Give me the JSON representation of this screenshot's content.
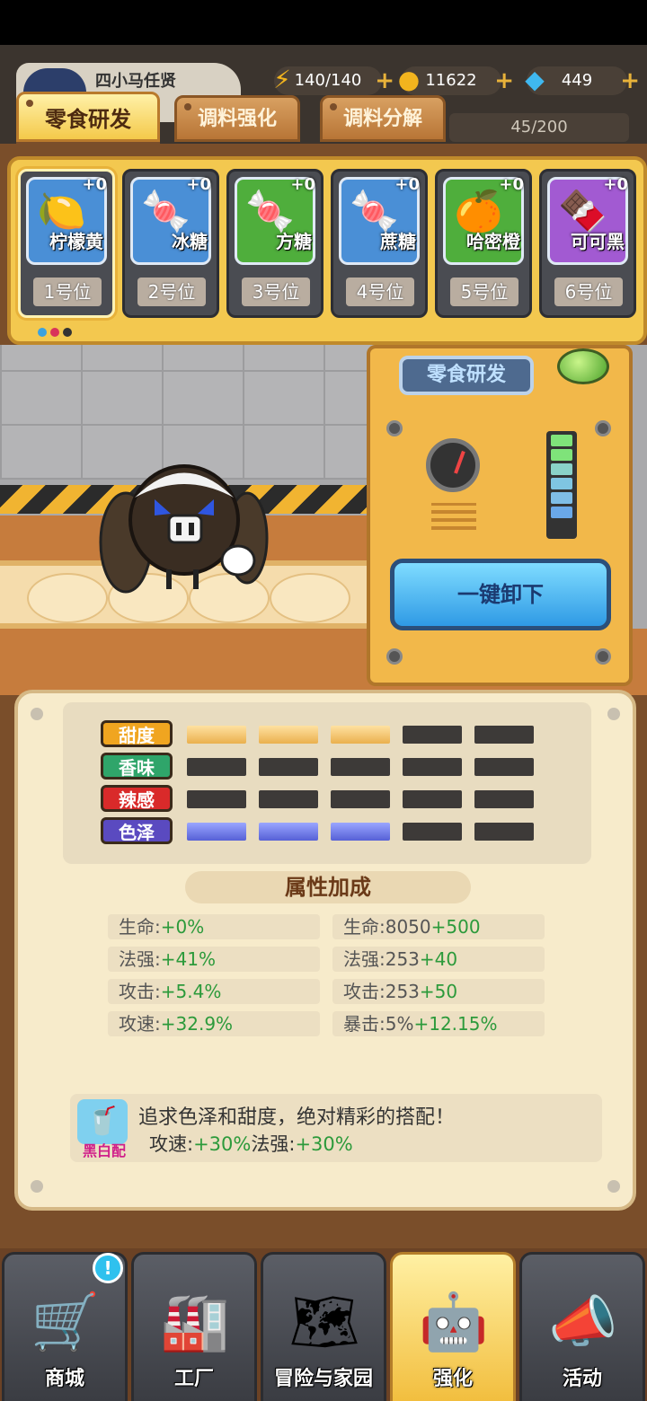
{
  "player": {
    "name": "四小马任贤"
  },
  "resources": {
    "stamina": {
      "value": "140/140",
      "icon": "lightning-icon"
    },
    "gold": {
      "value": "11622",
      "icon": "coin-icon"
    },
    "gems": {
      "value": "449",
      "icon": "diamond-icon"
    },
    "capacity": "45/200"
  },
  "tabs": [
    {
      "label": "零食研发",
      "active": true
    },
    {
      "label": "调料强化",
      "active": false
    },
    {
      "label": "调料分解",
      "active": false
    }
  ],
  "slots": [
    {
      "name": "柠檬黄",
      "count": "+0",
      "position": "1号位",
      "color": "#4a8fd6",
      "icon": "🍋"
    },
    {
      "name": "冰糖",
      "count": "+0",
      "position": "2号位",
      "color": "#4a8fd6",
      "icon": "🍬"
    },
    {
      "name": "方糖",
      "count": "+0",
      "position": "3号位",
      "color": "#4fae3c",
      "icon": "🍬"
    },
    {
      "name": "蔗糖",
      "count": "+0",
      "position": "4号位",
      "color": "#4a8fd6",
      "icon": "🍬"
    },
    {
      "name": "哈密橙",
      "count": "+0",
      "position": "5号位",
      "color": "#4fae3c",
      "icon": "🍊"
    },
    {
      "name": "可可黑",
      "count": "+0",
      "position": "6号位",
      "color": "#a25ad2",
      "icon": "🍫"
    }
  ],
  "machine": {
    "title": "零食研发",
    "unload_label": "一键卸下"
  },
  "attributes": [
    {
      "label": "甜度",
      "color": "#f0a520",
      "filled": 3,
      "max": 5,
      "style": "sweet"
    },
    {
      "label": "香味",
      "color": "#2fa56a",
      "filled": 0,
      "max": 5,
      "style": "none"
    },
    {
      "label": "辣感",
      "color": "#d92a2a",
      "filled": 0,
      "max": 5,
      "style": "none"
    },
    {
      "label": "色泽",
      "color": "#5a4ac0",
      "filled": 3,
      "max": 5,
      "style": "color"
    }
  ],
  "bonus": {
    "title": "属性加成",
    "left": [
      {
        "label": "生命:",
        "value": "+0%"
      },
      {
        "label": "法强:",
        "value": "+41%"
      },
      {
        "label": "攻击:",
        "value": "+5.4%"
      },
      {
        "label": "攻速:",
        "value": "+32.9%"
      }
    ],
    "right": [
      {
        "label": "生命:8050",
        "value": "+500"
      },
      {
        "label": "法强:253",
        "value": "+40"
      },
      {
        "label": "攻击:253",
        "value": "+50"
      },
      {
        "label": "暴击:5%",
        "value": "+12.15%"
      }
    ]
  },
  "combo": {
    "name": "黑白配",
    "description": "追求色泽和甜度，绝对精彩的搭配！",
    "effect1_label": "攻速:",
    "effect1_value": "+30%",
    "effect2_label": "法强:",
    "effect2_value": "+30%"
  },
  "nav": [
    {
      "label": "商城",
      "icon": "🛒",
      "badge": "!",
      "active": false
    },
    {
      "label": "工厂",
      "icon": "🏭",
      "active": false
    },
    {
      "label": "冒险与家园",
      "icon": "🗺",
      "active": false
    },
    {
      "label": "强化",
      "icon": "🤖",
      "active": true
    },
    {
      "label": "活动",
      "icon": "📣",
      "active": false
    }
  ]
}
